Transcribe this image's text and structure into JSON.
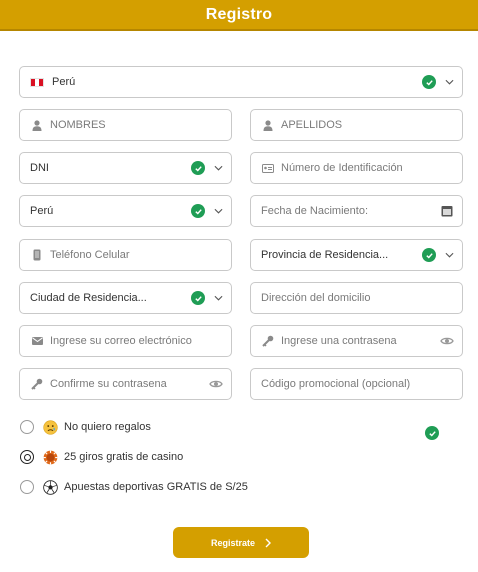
{
  "header": {
    "title": "Registro"
  },
  "form": {
    "country_top": "Perú",
    "nombres_placeholder": "NOMBRES",
    "apellidos_placeholder": "APELLIDOS",
    "doc_type": "DNI",
    "doc_number_placeholder": "Número de Identificación",
    "nationality": "Perú",
    "birthdate_placeholder": "Fecha de Nacimiento:",
    "phone_placeholder": "Teléfono Celular",
    "province": "Provincia de Residencia...",
    "city": "Ciudad de Residencia...",
    "address_placeholder": "Dirección del domicilio",
    "email_placeholder": "Ingrese su correo electrónico",
    "password_placeholder": "Ingrese una contrasena",
    "confirm_password_placeholder": "Confirme su contrasena",
    "promo_placeholder": "Código promocional (opcional)"
  },
  "bonus_options": [
    {
      "label": "No quiero regalos",
      "icon": "sad-face-icon",
      "selected": false
    },
    {
      "label": "25 giros gratis de casino",
      "icon": "casino-chip-icon",
      "selected": true
    },
    {
      "label": "Apuestas deportivas GRATIS de S/25",
      "icon": "soccer-ball-icon",
      "selected": false
    }
  ],
  "submit": {
    "label": "Registrate"
  },
  "colors": {
    "accent": "#d49f00",
    "success": "#1f9d55",
    "border": "#c9c9c9"
  }
}
